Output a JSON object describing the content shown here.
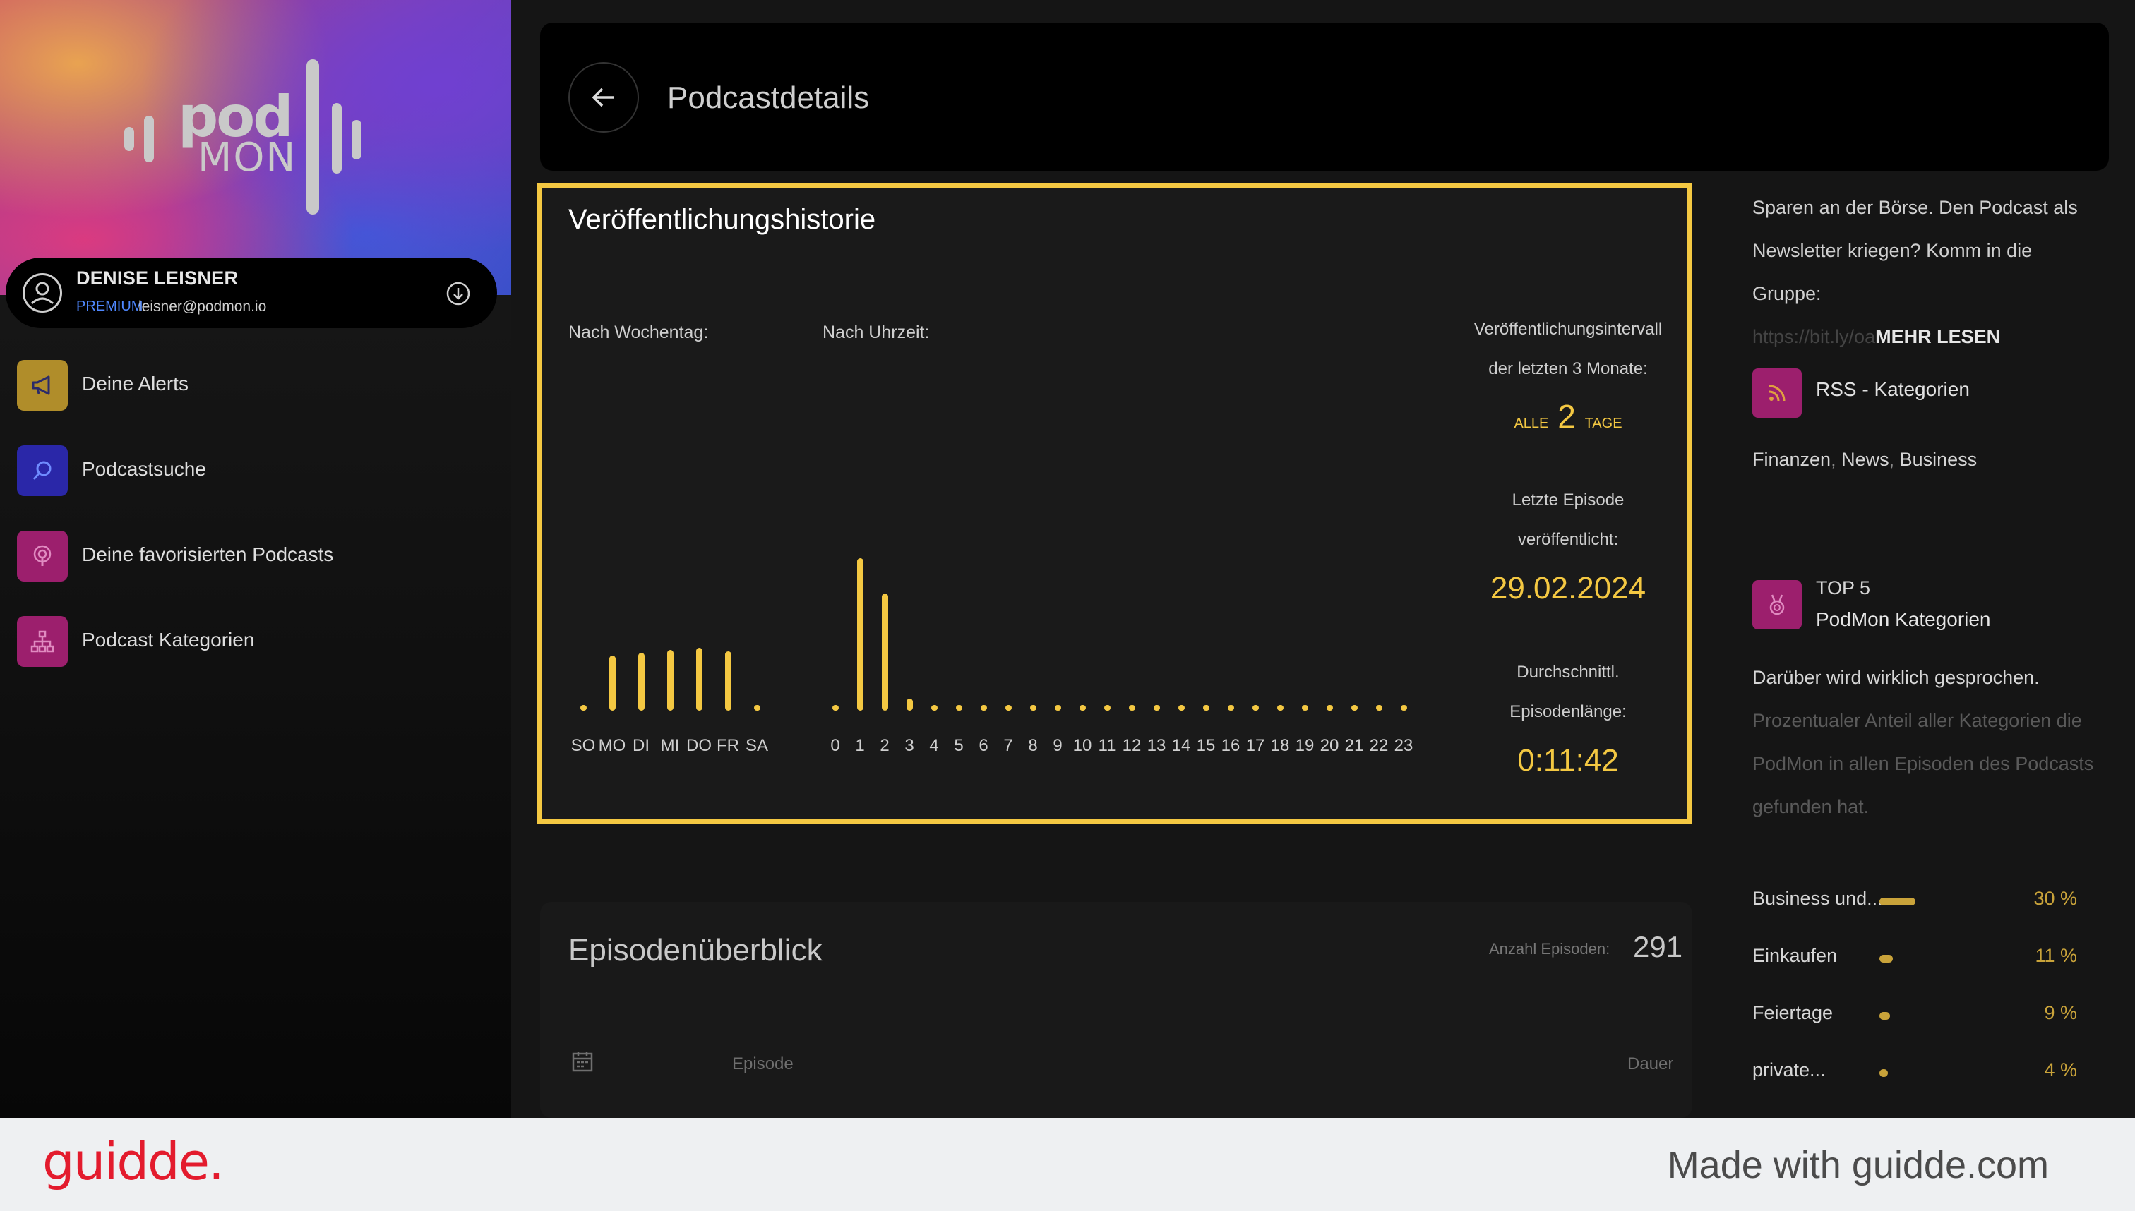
{
  "sidebar": {
    "logo": {
      "line1": "pod",
      "line2": "MON"
    },
    "user": {
      "name": "DENISE LEISNER",
      "plan": "PREMIUM",
      "email": "leisner@podmon.io"
    },
    "nav": [
      {
        "label": "Deine Alerts",
        "icon": "megaphone-icon",
        "color": "#b08d2a"
      },
      {
        "label": "Podcastsuche",
        "icon": "search-icon",
        "color": "#2a27a8"
      },
      {
        "label": "Deine favorisierten Podcasts",
        "icon": "podcast-icon",
        "color": "#9c1f6d"
      },
      {
        "label": "Podcast Kategorien",
        "icon": "hierarchy-icon",
        "color": "#9c1f6d"
      }
    ]
  },
  "header": {
    "title": "Podcastdetails",
    "back_icon": "arrow-left-icon"
  },
  "history": {
    "title": "Veröffentlichungshistorie",
    "weekday_label": "Nach Wochentag:",
    "hour_label": "Nach Uhrzeit:",
    "weekdays": {
      "labels": [
        "SO",
        "MO",
        "DI",
        "MI",
        "DO",
        "FR",
        "SA"
      ],
      "values": [
        0.02,
        0.36,
        0.38,
        0.4,
        0.41,
        0.39,
        0.02
      ]
    },
    "hours": {
      "labels": [
        "0",
        "1",
        "2",
        "3",
        "4",
        "5",
        "6",
        "7",
        "8",
        "9",
        "10",
        "11",
        "12",
        "13",
        "14",
        "15",
        "16",
        "17",
        "18",
        "19",
        "20",
        "21",
        "22",
        "23"
      ],
      "values": [
        0.02,
        1.0,
        0.77,
        0.08,
        0.02,
        0.02,
        0.02,
        0.02,
        0.02,
        0.02,
        0.02,
        0.02,
        0.02,
        0.02,
        0.02,
        0.02,
        0.02,
        0.02,
        0.02,
        0.02,
        0.02,
        0.02,
        0.02,
        0.02
      ]
    },
    "interval": {
      "label_line1": "Veröffentlichungsintervall",
      "label_line2": "der letzten 3 Monate:",
      "prefix": "ALLE",
      "value": "2",
      "suffix": "TAGE"
    },
    "last_episode": {
      "label_line1": "Letzte Episode",
      "label_line2": "veröffentlicht:",
      "value": "29.02.2024"
    },
    "avg_length": {
      "label_line1": "Durchschnittl.",
      "label_line2": "Episodenlänge:",
      "value": "0:11:42"
    }
  },
  "episodes": {
    "title": "Episodenüberblick",
    "count_label": "Anzahl Episoden:",
    "count": "291",
    "col_episode": "Episode",
    "col_duration": "Dauer"
  },
  "right": {
    "desc_line1": "Sparen an der Börse. Den Podcast als",
    "desc_line2": "Newsletter kriegen? Komm in die Gruppe:",
    "desc_link": "https://bit.ly/oa",
    "more": "MEHR LESEN",
    "rss_title": "RSS - Kategorien",
    "rss_cats": [
      "Finanzen",
      "News",
      "Business"
    ],
    "top5_line1": "TOP 5",
    "top5_line2": "PodMon Kategorien",
    "top5_desc1": "Darüber wird wirklich gesprochen.",
    "top5_desc2": "Prozentualer Anteil aller Kategorien die",
    "top5_desc3": "PodMon in allen Episoden des Podcasts",
    "top5_desc4": "gefunden hat.",
    "categories": [
      {
        "label": "Business und...",
        "pct": 30,
        "display": "30 %"
      },
      {
        "label": "Einkaufen",
        "pct": 11,
        "display": "11 %"
      },
      {
        "label": "Feiertage",
        "pct": 9,
        "display": "9 %"
      },
      {
        "label": "private...",
        "pct": 4,
        "display": "4 %"
      }
    ]
  },
  "footer": {
    "brand": "guidde.",
    "made_with": "Made with guidde.com"
  },
  "colors": {
    "accent": "#f4c842",
    "pink": "#9c1f6d",
    "gold": "#c9a33a"
  }
}
